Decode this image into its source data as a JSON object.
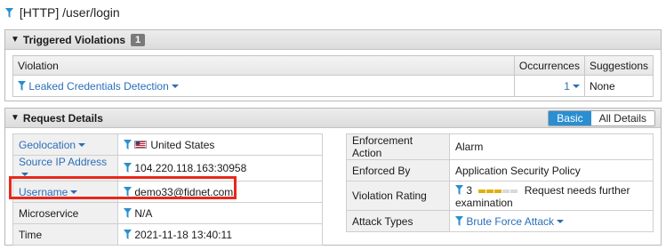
{
  "page": {
    "title": "[HTTP] /user/login"
  },
  "violations": {
    "header": "Triggered Violations",
    "count": "1",
    "columns": [
      "Violation",
      "Occurrences",
      "Suggestions"
    ],
    "rows": [
      {
        "violation": "Leaked Credentials Detection",
        "occurrences": "1",
        "suggestions": "None"
      }
    ]
  },
  "request": {
    "header": "Request Details",
    "view_basic": "Basic",
    "view_all": "All Details",
    "left": [
      {
        "label": "Geolocation",
        "value": "United States"
      },
      {
        "label": "Source IP Address",
        "value": "104.220.118.163:30958"
      },
      {
        "label": "Username",
        "value": "demo33@fidnet.com"
      },
      {
        "label": "Microservice",
        "value": "N/A"
      },
      {
        "label": "Time",
        "value": "2021-11-18 13:40:11"
      }
    ],
    "right": [
      {
        "label": "Enforcement Action",
        "value": "Alarm"
      },
      {
        "label": "Enforced By",
        "value": "Application Security Policy"
      },
      {
        "label": "Violation Rating",
        "value_num": "3",
        "value_text": "Request needs further examination",
        "rating": 3,
        "rating_max": 5
      },
      {
        "label": "Attack Types",
        "value": "Brute Force Attack"
      }
    ]
  },
  "colors": {
    "accent": "#2a8fd0",
    "link": "#2a6ebb",
    "highlight": "#e8281a",
    "rating": "#e0b010"
  },
  "icons": [
    "filter-icon",
    "collapse-icon",
    "chevron-down-icon",
    "us-flag-icon"
  ]
}
